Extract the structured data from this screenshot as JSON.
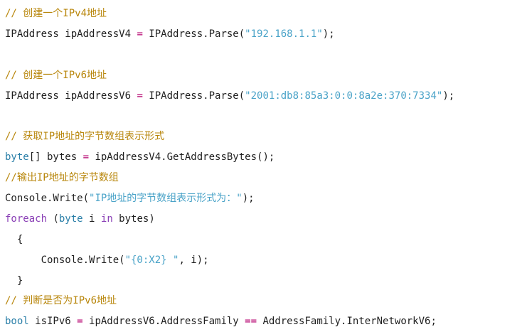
{
  "code_view": {
    "lines": [
      [
        {
          "t": "// 创建一个IPv4地址",
          "c": "comment"
        }
      ],
      [
        {
          "t": "IPAddress ipAddressV4 ",
          "c": "plain"
        },
        {
          "t": "=",
          "c": "op"
        },
        {
          "t": " IPAddress.Parse(",
          "c": "plain"
        },
        {
          "t": "\"192.168.1.1\"",
          "c": "string"
        },
        {
          "t": ");",
          "c": "plain"
        }
      ],
      [],
      [
        {
          "t": "// 创建一个IPv6地址",
          "c": "comment"
        }
      ],
      [
        {
          "t": "IPAddress ipAddressV6 ",
          "c": "plain"
        },
        {
          "t": "=",
          "c": "op"
        },
        {
          "t": " IPAddress.Parse(",
          "c": "plain"
        },
        {
          "t": "\"2001:db8:85a3:0:0:8a2e:370:7334\"",
          "c": "string"
        },
        {
          "t": ");",
          "c": "plain"
        }
      ],
      [],
      [
        {
          "t": "// 获取IP地址的字节数组表示形式",
          "c": "comment"
        }
      ],
      [
        {
          "t": "byte",
          "c": "type"
        },
        {
          "t": "[] bytes ",
          "c": "plain"
        },
        {
          "t": "=",
          "c": "op"
        },
        {
          "t": " ipAddressV4.GetAddressBytes();",
          "c": "plain"
        }
      ],
      [
        {
          "t": "//输出IP地址的字节数组",
          "c": "comment"
        }
      ],
      [
        {
          "t": "Console.Write(",
          "c": "plain"
        },
        {
          "t": "\"IP地址的字节数组表示形式为：\"",
          "c": "string"
        },
        {
          "t": ");",
          "c": "plain"
        }
      ],
      [
        {
          "t": "foreach",
          "c": "keyword"
        },
        {
          "t": " (",
          "c": "plain"
        },
        {
          "t": "byte",
          "c": "type"
        },
        {
          "t": " i ",
          "c": "plain"
        },
        {
          "t": "in",
          "c": "keyword"
        },
        {
          "t": " bytes)",
          "c": "plain"
        }
      ],
      [
        {
          "t": "  {",
          "c": "plain"
        }
      ],
      [
        {
          "t": "      Console.Write(",
          "c": "plain"
        },
        {
          "t": "\"{0:X2} \"",
          "c": "string"
        },
        {
          "t": ", i);",
          "c": "plain"
        }
      ],
      [
        {
          "t": "  }",
          "c": "plain"
        }
      ],
      [
        {
          "t": "// 判断是否为IPv6地址",
          "c": "comment"
        }
      ],
      [
        {
          "t": "bool",
          "c": "type"
        },
        {
          "t": " isIPv6 ",
          "c": "plain"
        },
        {
          "t": "=",
          "c": "op"
        },
        {
          "t": " ipAddressV6.AddressFamily ",
          "c": "plain"
        },
        {
          "t": "==",
          "c": "op"
        },
        {
          "t": " AddressFamily.InterNetworkV6;",
          "c": "plain"
        }
      ]
    ]
  }
}
